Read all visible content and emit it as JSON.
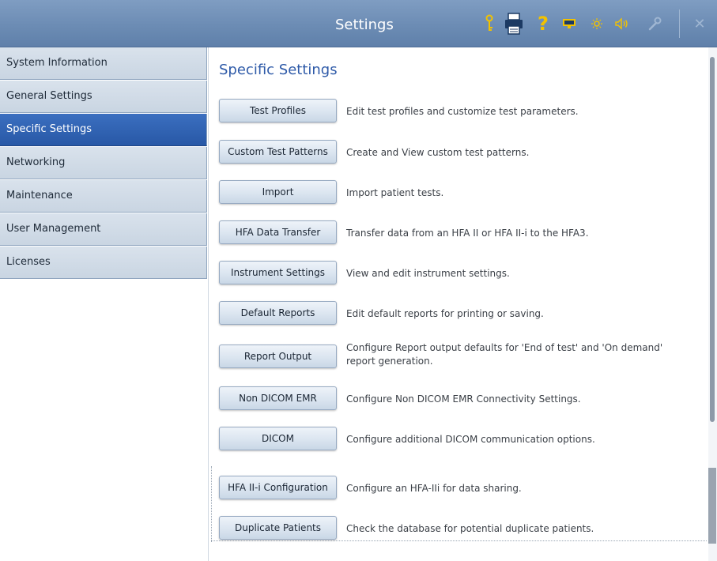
{
  "window": {
    "title": "Settings",
    "icons": [
      "key-icon",
      "printer-icon",
      "help-icon",
      "display-icon",
      "brightness-icon",
      "volume-icon",
      "wrench-icon",
      "close-icon"
    ],
    "help_glyph": "?",
    "close_glyph": "✕"
  },
  "sidebar": {
    "items": [
      {
        "label": "System Information"
      },
      {
        "label": "General Settings"
      },
      {
        "label": "Specific Settings",
        "selected": true
      },
      {
        "label": "Networking"
      },
      {
        "label": "Maintenance"
      },
      {
        "label": "User Management"
      },
      {
        "label": "Licenses"
      }
    ]
  },
  "main": {
    "title": "Specific Settings",
    "rows": [
      {
        "button": "Test Profiles",
        "description": "Edit test profiles and customize test parameters."
      },
      {
        "button": "Custom Test Patterns",
        "description": "Create and View custom test patterns."
      },
      {
        "button": "Import",
        "description": "Import patient tests."
      },
      {
        "button": "HFA Data Transfer",
        "description": "Transfer data from an HFA II or HFA II-i to the HFA3."
      },
      {
        "button": "Instrument Settings",
        "description": "View and edit instrument settings."
      },
      {
        "button": "Default Reports",
        "description": "Edit default reports for printing or saving."
      },
      {
        "button": "Report Output",
        "description": "Configure Report output defaults for 'End of test' and 'On demand' report generation."
      },
      {
        "button": "Non DICOM EMR",
        "description": "Configure Non DICOM EMR Connectivity Settings."
      },
      {
        "button": "DICOM",
        "description": "Configure additional DICOM communication options."
      },
      {
        "button": "HFA II-i Configuration",
        "description": "Configure an HFA-IIi for data sharing."
      },
      {
        "button": "Duplicate Patients",
        "description": "Check the database for potential duplicate patients."
      }
    ]
  },
  "colors": {
    "titlebar": "#6c8cb4",
    "accent": "#2e5aa8",
    "selected_nav": "#2858a6"
  }
}
